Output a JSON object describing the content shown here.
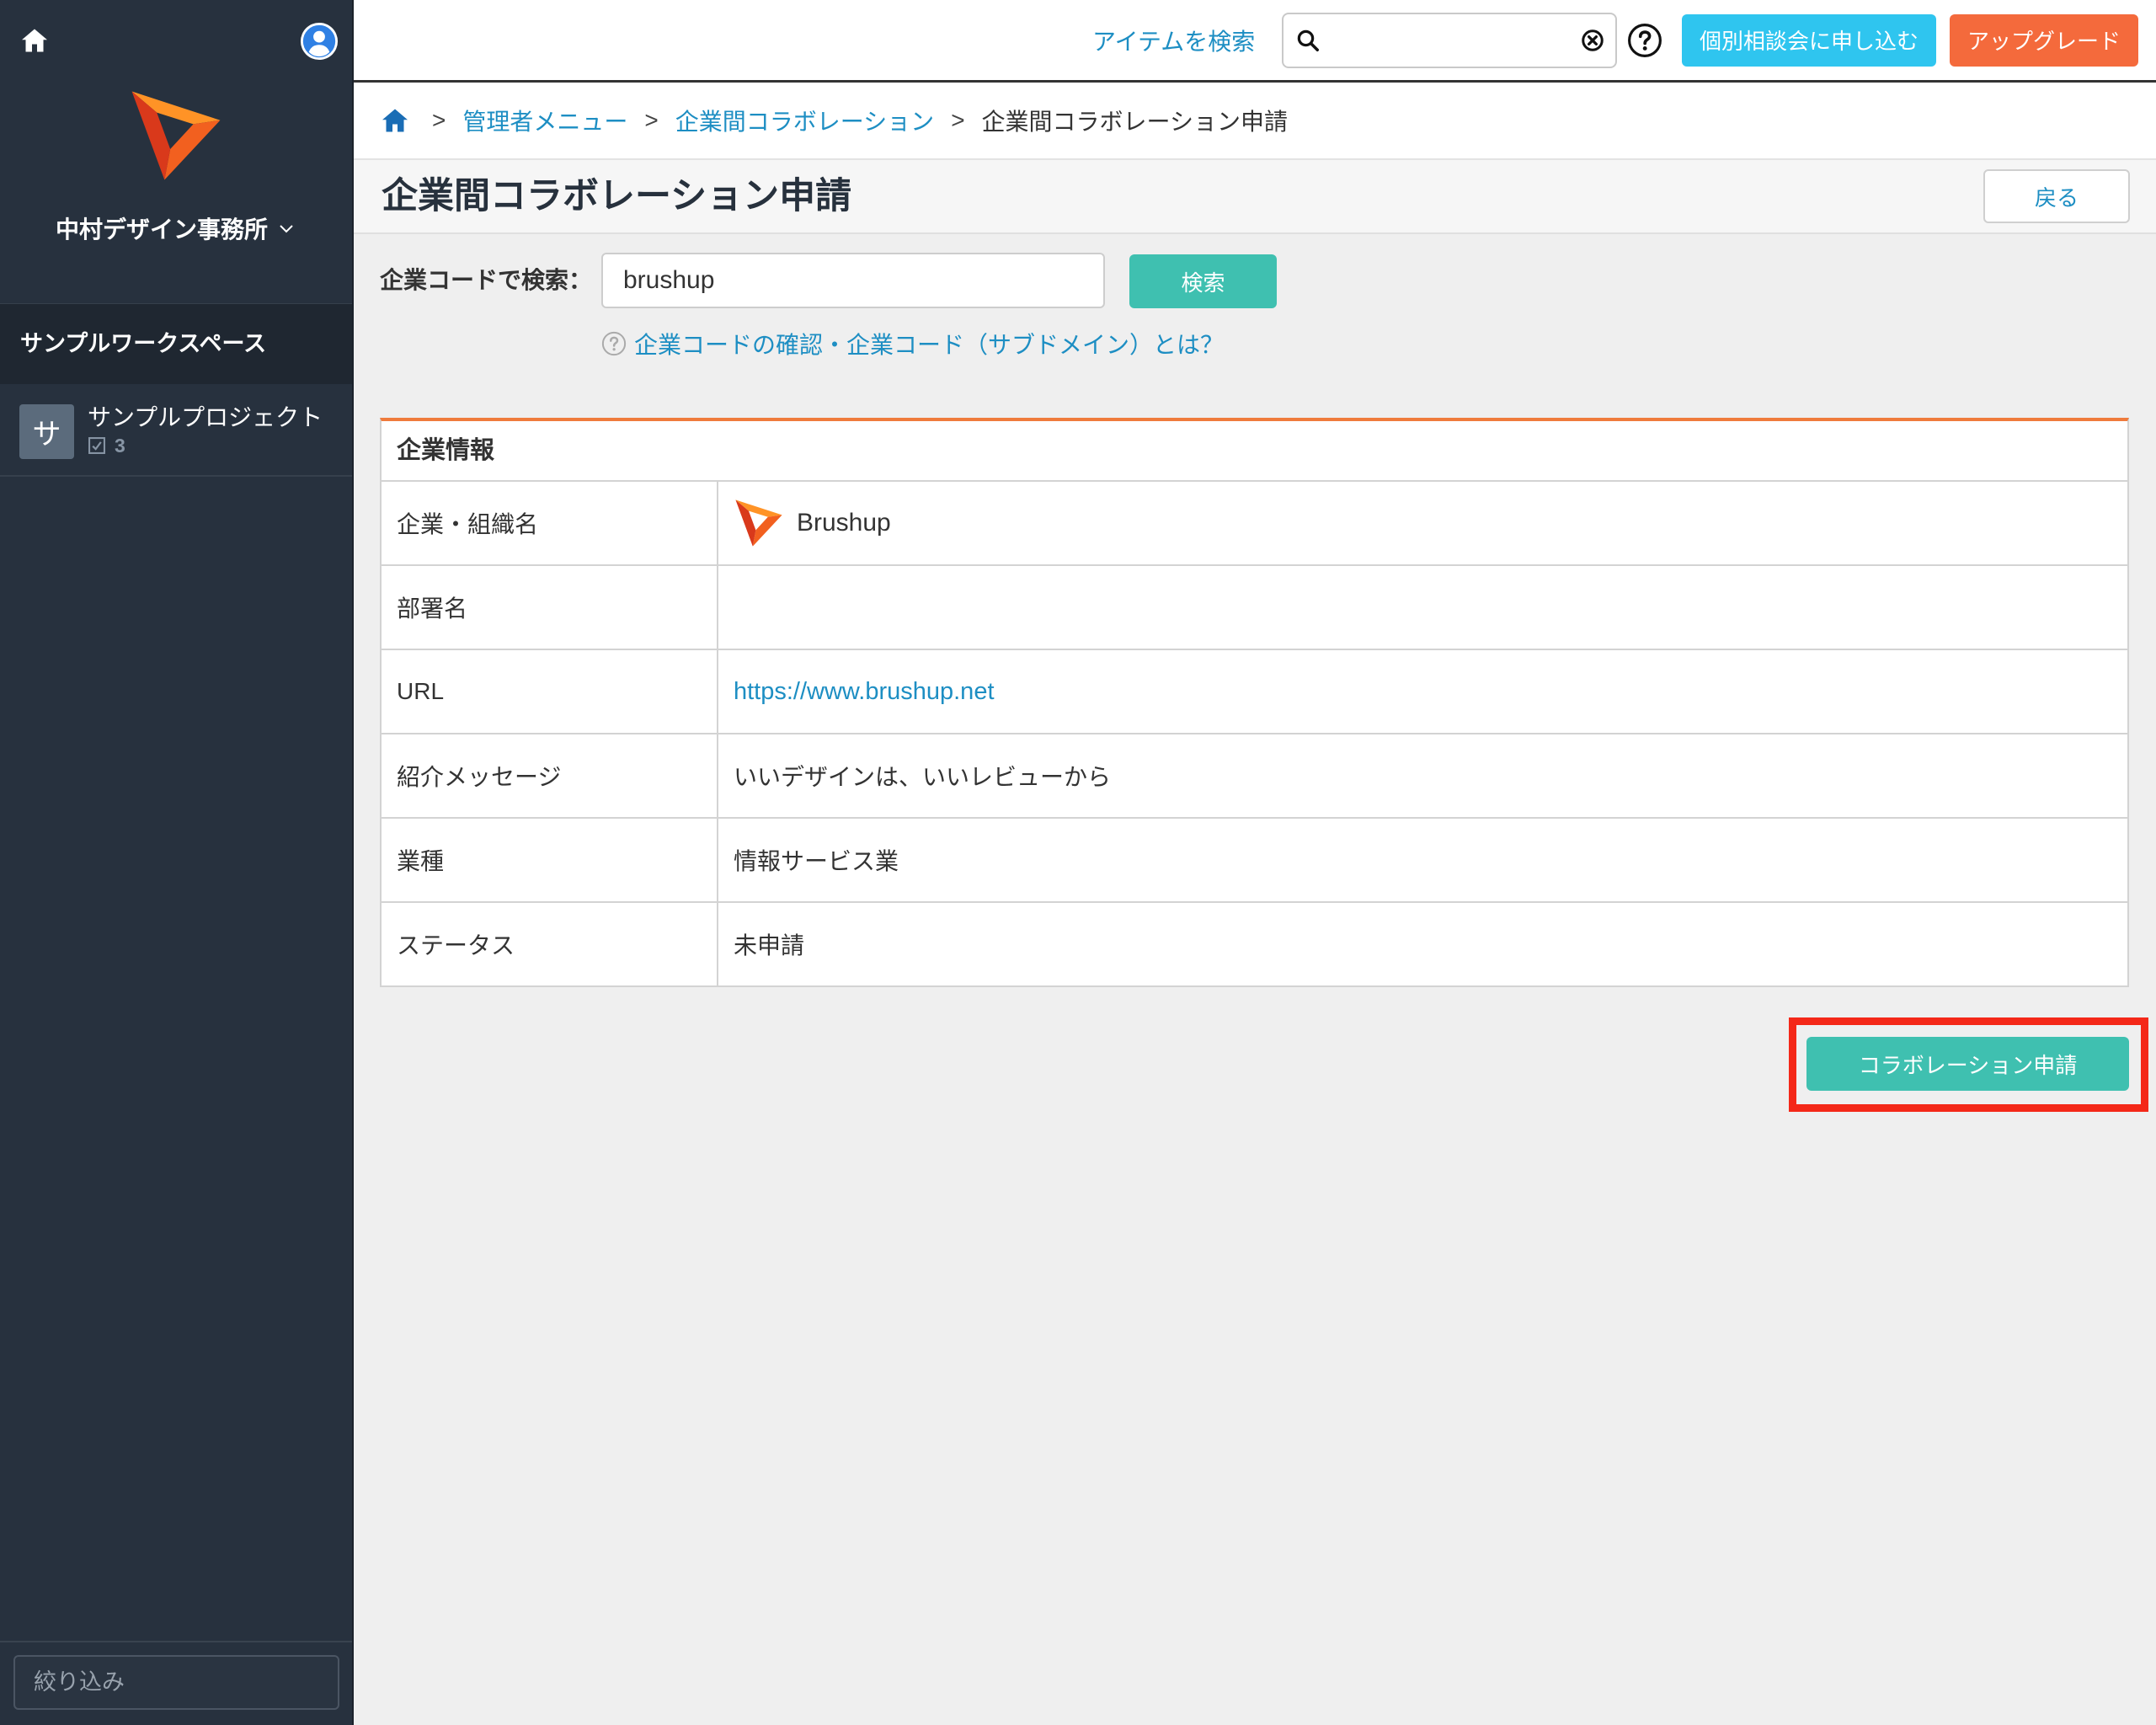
{
  "colors": {
    "sidebar": "#27313e",
    "sidebar-dark": "#1f2731",
    "link": "#1d8ec3",
    "teal": "#3fc0b0",
    "cyan": "#2fc5ef",
    "orange": "#f46a3c",
    "table-accent": "#ef7b3c",
    "highlight": "#f42818",
    "title": "#27313d"
  },
  "icons": {
    "sidebar_home": "home-icon",
    "account": "user-avatar-icon",
    "logo": "brushup-logo-icon",
    "org_menu": "chevron-down-icon",
    "task_count": "task-checkbox-icon",
    "search": "search-icon",
    "clear": "clear-circle-icon",
    "help": "help-icon",
    "breadcrumb_home": "home-icon"
  },
  "sidebar": {
    "org_name": "中村デザイン事務所",
    "workspace_title": "サンプルワークスペース",
    "projects": [
      {
        "initial": "サ",
        "name": "サンプルプロジェクト",
        "task_count": "3"
      }
    ],
    "filter_placeholder": "絞り込み"
  },
  "header": {
    "search_link": "アイテムを検索",
    "search_value": "",
    "consult_button": "個別相談会に申し込む",
    "upgrade_button": "アップグレード"
  },
  "breadcrumb": {
    "separator": ">",
    "links": [
      {
        "label": "管理者メニュー"
      },
      {
        "label": "企業間コラボレーション"
      }
    ],
    "current": "企業間コラボレーション申請"
  },
  "page": {
    "title": "企業間コラボレーション申請",
    "back_button": "戻る"
  },
  "company_search": {
    "label": "企業コードで検索：",
    "value": "brushup",
    "button": "検索",
    "help_link": "企業コードの確認・企業コード（サブドメイン）とは？"
  },
  "company_info": {
    "heading": "企業情報",
    "rows": [
      {
        "label": "企業・組織名",
        "value": "Brushup"
      },
      {
        "label": "部署名",
        "value": ""
      },
      {
        "label": "URL",
        "value": "https://www.brushup.net"
      },
      {
        "label": "紹介メッセージ",
        "value": "いいデザインは、いいレビューから"
      },
      {
        "label": "業種",
        "value": "情報サービス業"
      },
      {
        "label": "ステータス",
        "value": "未申請"
      }
    ]
  },
  "actions": {
    "collab_request_button": "コラボレーション申請"
  }
}
